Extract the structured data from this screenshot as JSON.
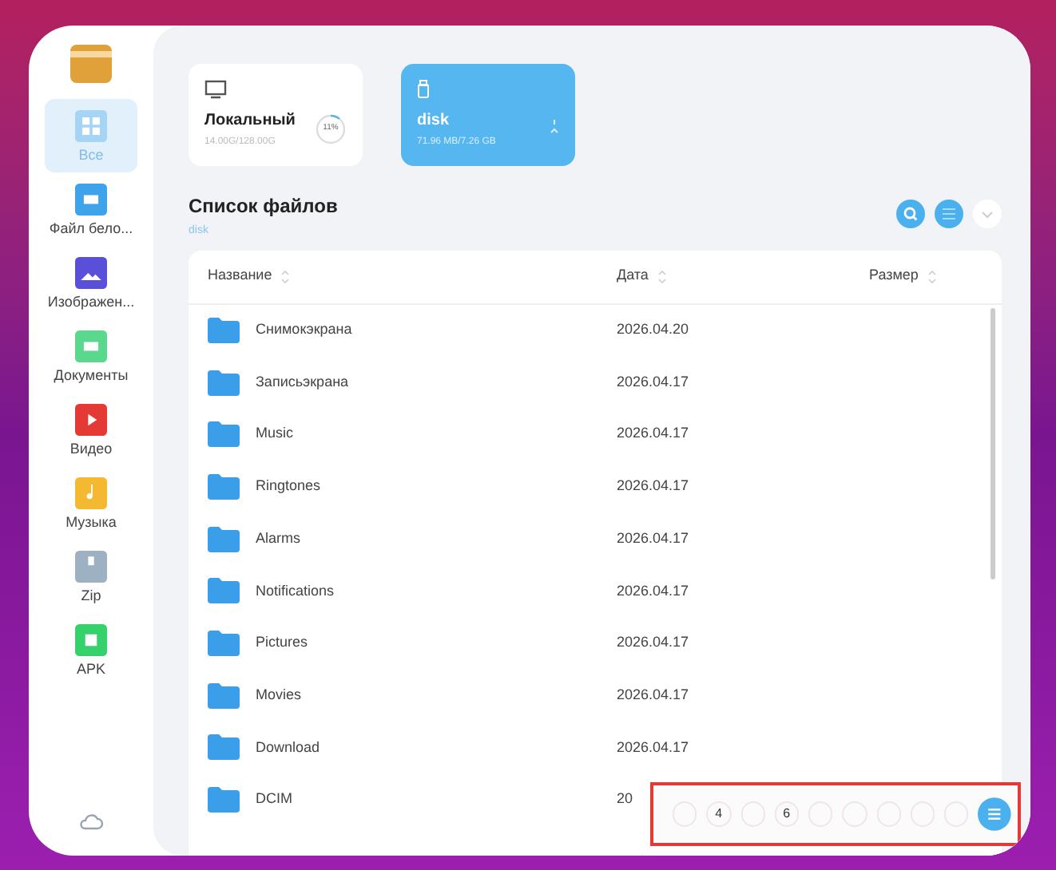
{
  "sidebar": {
    "items": [
      {
        "label": "Все",
        "kind": "all",
        "color": "#a6d4f5",
        "selected": true
      },
      {
        "label": "Файл бело...",
        "kind": "doc",
        "color": "#3fa3ec",
        "selected": false
      },
      {
        "label": "Изображен...",
        "kind": "image",
        "color": "#5a4fd8",
        "selected": false
      },
      {
        "label": "Документы",
        "kind": "doc",
        "color": "#5ad88e",
        "selected": false
      },
      {
        "label": "Видео",
        "kind": "video",
        "color": "#e53935",
        "selected": false
      },
      {
        "label": "Музыка",
        "kind": "music",
        "color": "#f5b931",
        "selected": false
      },
      {
        "label": "Zip",
        "kind": "zip",
        "color": "#9eb1c2",
        "selected": false
      },
      {
        "label": "APK",
        "kind": "apk",
        "color": "#35d16a",
        "selected": false
      }
    ]
  },
  "storage": [
    {
      "kind": "local",
      "name": "Локальный",
      "usage": "14.00G/128.00G",
      "percent": "11%",
      "level": 0.11,
      "selected": false
    },
    {
      "kind": "usb",
      "name": "disk",
      "usage": "71.96 MB/7.26 GB",
      "selected": true
    }
  ],
  "file_list": {
    "title": "Список файлов",
    "path": "disk",
    "columns": [
      "Название",
      "Дата",
      "Размер"
    ],
    "rows": [
      {
        "name": "Снимокэкрана",
        "date": "2026.04.20"
      },
      {
        "name": "Записьэкрана",
        "date": "2026.04.17"
      },
      {
        "name": "Music",
        "date": "2026.04.17"
      },
      {
        "name": "Ringtones",
        "date": "2026.04.17"
      },
      {
        "name": "Alarms",
        "date": "2026.04.17"
      },
      {
        "name": "Notifications",
        "date": "2026.04.17"
      },
      {
        "name": "Pictures",
        "date": "2026.04.17"
      },
      {
        "name": "Movies",
        "date": "2026.04.17"
      },
      {
        "name": "Download",
        "date": "2026.04.17"
      },
      {
        "name": "DCIM",
        "date": "20"
      }
    ]
  },
  "bottom_toolbar": {
    "labels": [
      "4",
      "6"
    ]
  }
}
